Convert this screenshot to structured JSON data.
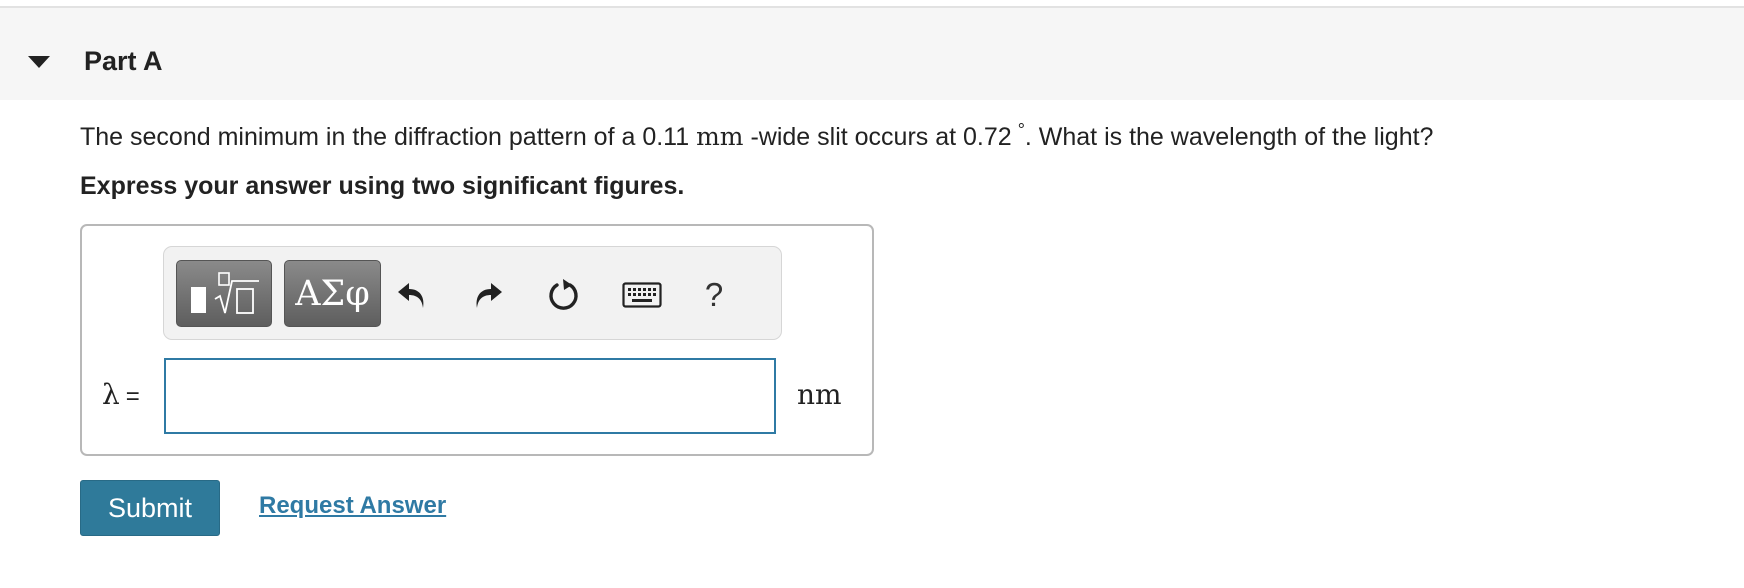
{
  "part": {
    "title": "Part A"
  },
  "question": {
    "text_before_width": "The second minimum in the diffraction pattern of a 0.11",
    "width_unit": "mm",
    "text_after_width": "-wide slit occurs at 0.72",
    "angle_unit": "°",
    "text_end": ". What is the wavelength of the light?"
  },
  "instruction": "Express your answer using two significant figures.",
  "toolbar": {
    "templates_icon": "templates-icon",
    "symbols_label": "ΑΣφ",
    "undo_icon": "undo-icon",
    "redo_icon": "redo-icon",
    "reset_icon": "reset-icon",
    "keyboard_icon": "keyboard-icon",
    "help_label": "?"
  },
  "answer": {
    "variable": "λ",
    "equals": "=",
    "value": "",
    "unit": "nm"
  },
  "actions": {
    "submit_label": "Submit",
    "request_answer_label": "Request Answer"
  },
  "colors": {
    "accent": "#2f7a9a",
    "link": "#2f7aa4",
    "input_border": "#2f7aa4"
  }
}
